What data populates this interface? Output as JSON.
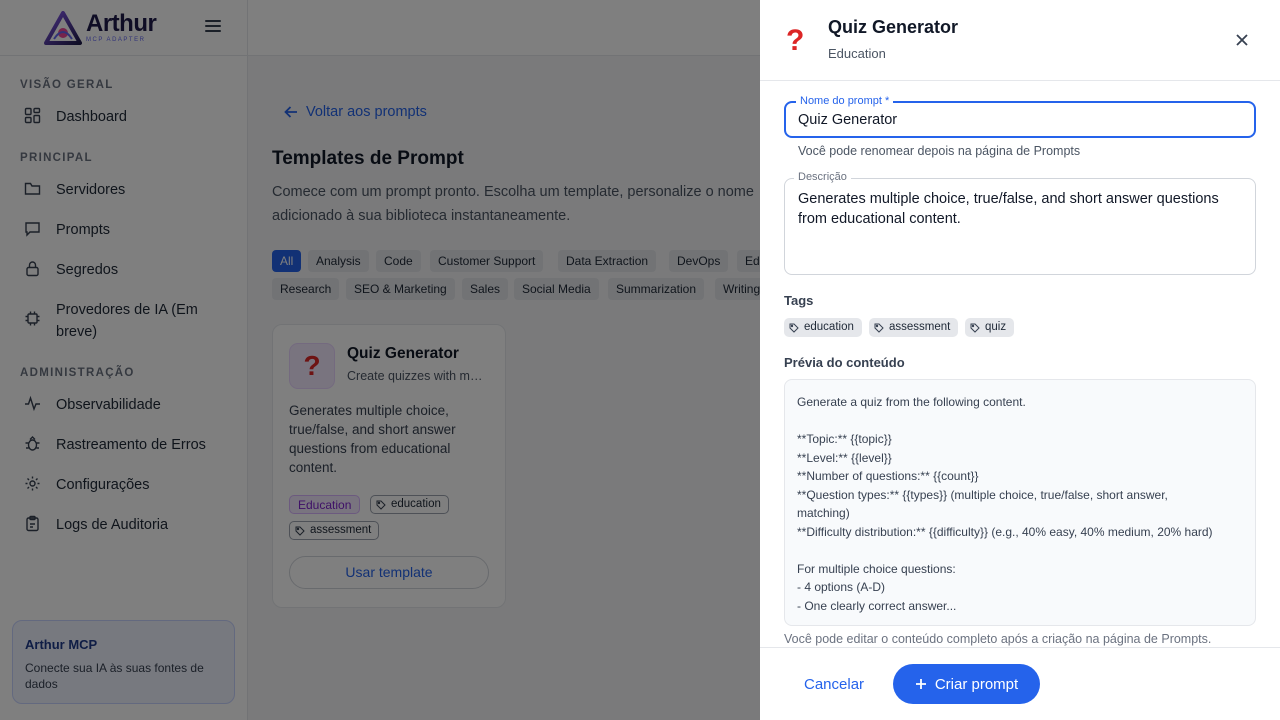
{
  "brand": {
    "name": "Arthur",
    "subtitle": "MCP ADAPTER",
    "colors": {
      "primary": "#2563eb",
      "brand_dark": "#1e1b4b",
      "accent": "#7e22ce"
    }
  },
  "sidebar": {
    "sections": {
      "overview": "VISÃO GERAL",
      "main": "PRINCIPAL",
      "admin": "ADMINISTRAÇÃO"
    },
    "items": {
      "dashboard": {
        "label": "Dashboard",
        "icon": "grid-icon"
      },
      "servers": {
        "label": "Servidores",
        "icon": "folder-icon"
      },
      "prompts": {
        "label": "Prompts",
        "icon": "chat-icon"
      },
      "secrets": {
        "label": "Segredos",
        "icon": "lock-icon"
      },
      "ai_providers": {
        "label": "Provedores de IA (Em breve)",
        "icon": "chip-icon"
      },
      "observability": {
        "label": "Observabilidade",
        "icon": "pulse-icon"
      },
      "error_tracking": {
        "label": "Rastreamento de Erros",
        "icon": "bug-icon"
      },
      "settings": {
        "label": "Configurações",
        "icon": "gear-icon"
      },
      "audit_logs": {
        "label": "Logs de Auditoria",
        "icon": "clipboard-icon"
      }
    },
    "promo": {
      "title": "Arthur MCP",
      "subtitle": "Conecte sua IA às suas fontes de dados"
    }
  },
  "main": {
    "back_label": "Voltar aos prompts",
    "title": "Templates de Prompt",
    "description_line1": "Comece com um prompt pronto. Escolha um template, personalize o nome",
    "description_line2": "adicionado à sua biblioteca instantaneamente.",
    "filters": {
      "all": "All",
      "analysis": "Analysis",
      "code": "Code",
      "support": "Customer Support",
      "extraction": "Data Extraction",
      "devops": "DevOps",
      "education": "Ed",
      "research": "Research",
      "seo": "SEO & Marketing",
      "sales": "Sales",
      "social": "Social Media",
      "summarization": "Summarization",
      "writing": "Writing"
    },
    "card": {
      "icon": "question-mark-icon",
      "title": "Quiz Generator",
      "subtitle": "Create quizzes with multiple question types",
      "description": "Generates multiple choice, true/false, and short answer questions from educational content.",
      "category": "Education",
      "tags": [
        "education",
        "assessment"
      ],
      "use_label": "Usar template"
    }
  },
  "drawer": {
    "icon": "question-mark-icon",
    "title": "Quiz Generator",
    "category": "Education",
    "name_label": "Nome do prompt *",
    "name_value": "Quiz Generator",
    "name_helper": "Você pode renomear depois na página de Prompts",
    "desc_label": "Descrição",
    "desc_value": "Generates multiple choice, true/false, and short answer questions from educational content.",
    "tags_label": "Tags",
    "tags": [
      "education",
      "assessment",
      "quiz"
    ],
    "preview_label": "Prévia do conteúdo",
    "preview_lines": [
      "Generate a quiz from the following content.",
      "",
      "**Topic:** {{topic}}",
      "**Level:** {{level}}",
      "**Number of questions:** {{count}}",
      "**Question types:** {{types}} (multiple choice, true/false, short answer,",
      "matching)",
      "**Difficulty distribution:** {{difficulty}} (e.g., 40% easy, 40% medium, 20% hard)",
      "",
      "For multiple choice questions:",
      "- 4 options (A-D)",
      "- One clearly correct answer..."
    ],
    "edit_helper": "Você pode editar o conteúdo completo após a criação na página de Prompts.",
    "cancel_label": "Cancelar",
    "create_label": "Criar prompt"
  }
}
